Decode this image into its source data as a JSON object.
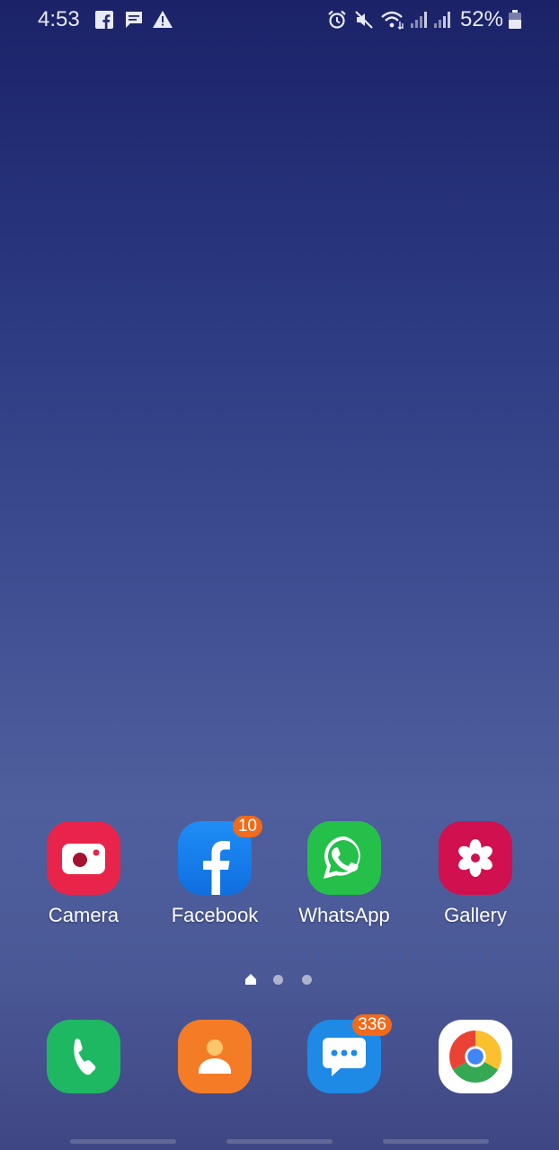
{
  "status_bar": {
    "time": "4:53",
    "battery_percent": "52%",
    "left_icons": [
      "facebook-notification-icon",
      "message-notification-icon",
      "warning-icon"
    ],
    "right_icons": [
      "alarm-icon",
      "mute-icon",
      "wifi-icon",
      "signal-icon",
      "signal-icon",
      "battery-icon"
    ]
  },
  "home_apps": [
    {
      "label": "Camera",
      "color": "#e8244a"
    },
    {
      "label": "Facebook",
      "color": "#1877f2",
      "badge": "10"
    },
    {
      "label": "WhatsApp",
      "color": "#25c04a"
    },
    {
      "label": "Gallery",
      "color": "#d0104f"
    }
  ],
  "dock_apps": [
    {
      "name": "Phone",
      "color": "#1fb862"
    },
    {
      "name": "Contacts",
      "color": "#f57c27"
    },
    {
      "name": "Messages",
      "color": "#1e8ae6",
      "badge": "336"
    },
    {
      "name": "Chrome",
      "color": "#ffffff"
    }
  ],
  "page_indicator": {
    "pages": 3,
    "current": 1
  },
  "colors": {
    "badge": "#f06b1b"
  }
}
